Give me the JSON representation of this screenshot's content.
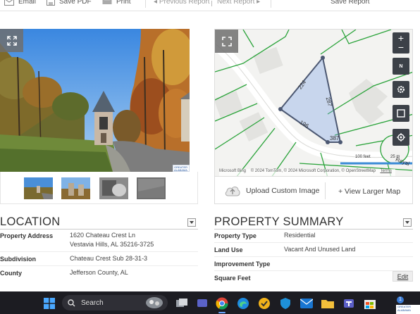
{
  "toolbar": {
    "email": "Email",
    "save_pdf": "Save PDF",
    "print": "Print",
    "previous_report": "Previous Report",
    "next_report": "Next Report",
    "save_report": "Save Report"
  },
  "photo": {
    "badge_text": "GREATER ALABAMA MLS",
    "thumbnail_count": 4
  },
  "map": {
    "lot_dims": [
      "224",
      "287",
      "196",
      "387"
    ],
    "street_label": "Royal",
    "scale_feet": "100 feet",
    "scale_m": "25 m",
    "attribution": [
      "Microsoft Bing",
      "© 2024 TomTom, © 2024 Microsoft Corporation, © OpenStreetMap",
      "Terms"
    ],
    "upload_label": "Upload Custom Image",
    "larger_label": "+ View Larger Map",
    "compass_label": "N"
  },
  "location": {
    "title": "LOCATION",
    "rows": [
      {
        "label": "Property Address",
        "value": "1620 Chateau Crest Ln",
        "value2": "Vestavia Hills, AL 35216-3725"
      },
      {
        "label": "Subdivision",
        "value": "Chateau Crest Sub 28-31-3"
      },
      {
        "label": "County",
        "value": "Jefferson County, AL"
      }
    ]
  },
  "summary": {
    "title": "PROPERTY SUMMARY",
    "rows": [
      {
        "label": "Property Type",
        "value": "Residential"
      },
      {
        "label": "Land Use",
        "value": "Vacant And Unused Land"
      },
      {
        "label": "Improvement Type",
        "value": ""
      },
      {
        "label": "Square Feet",
        "value": ""
      }
    ],
    "edit_label": "Edit"
  },
  "taskbar": {
    "search_placeholder": "Search",
    "notification_count": "1",
    "tray_logo_text": "GREATER ALABAMA"
  }
}
